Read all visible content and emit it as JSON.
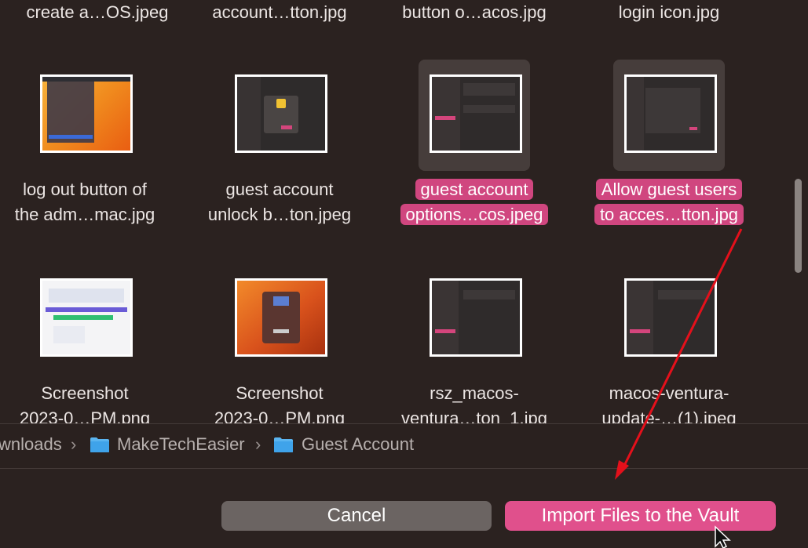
{
  "files": {
    "row0": [
      "create a…OS.jpeg",
      "account…tton.jpg",
      "button o…acos.jpg",
      "login icon.jpg"
    ],
    "row1": [
      {
        "line1": "log out button of",
        "line2": "the adm…mac.jpg"
      },
      {
        "line1": "guest account",
        "line2": "unlock b…ton.jpeg"
      },
      {
        "line1": "guest account",
        "line2": "options…cos.jpeg"
      },
      {
        "line1": "Allow guest users",
        "line2": "to acces…tton.jpg"
      }
    ],
    "row2": [
      {
        "line1": "Screenshot",
        "line2": "2023-0…PM.png"
      },
      {
        "line1": "Screenshot",
        "line2": "2023-0…PM.png"
      },
      {
        "line1": "rsz_macos-",
        "line2": "ventura…ton_1.jpg"
      },
      {
        "line1": "macos-ventura-",
        "line2": "update-…(1).jpeg"
      }
    ]
  },
  "path": {
    "items": [
      "wnloads",
      "MakeTechEasier",
      "Guest Account"
    ],
    "separator": "›"
  },
  "buttons": {
    "cancel": "Cancel",
    "import": "Import Files to the Vault"
  },
  "icons": [
    "folder-icon",
    "chevron-right-icon",
    "cursor-icon"
  ],
  "colors": {
    "background": "#2b2220",
    "selection": "#d0467f",
    "primary_button": "#e0508c",
    "secondary_button": "#6b6462",
    "annotation_arrow": "#e4101b"
  }
}
